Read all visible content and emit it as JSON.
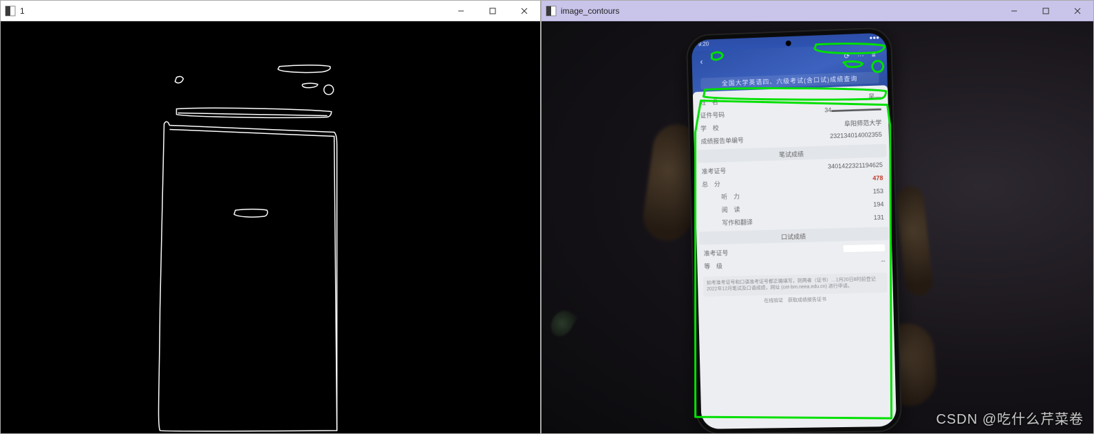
{
  "windows": {
    "w1": {
      "title": "1"
    },
    "w2": {
      "title": "image_contours"
    }
  },
  "phone": {
    "status_time": "9:20",
    "status_icons": "●●●",
    "header_back": "‹",
    "header_icons": "⟳  ⋯  ≡",
    "header_banner": "全国大学英语四、六级考试(含口试)成绩查询",
    "fields": {
      "name_lbl": "姓　名",
      "name_val": "吴—",
      "id_lbl": "证件号码",
      "id_val": "34▬▬▬▬▬▬▬▬",
      "school_lbl": "学　校",
      "school_val": "阜阳师范大学",
      "report_lbl": "成绩报告单编号",
      "report_val": "232134014002355"
    },
    "sec_written": "笔试成绩",
    "written": {
      "ticket_lbl": "准考证号",
      "ticket_val": "3401422321194625",
      "total_lbl": "总　分",
      "total_val": "478",
      "listen_lbl": "听　力",
      "listen_val": "153",
      "read_lbl": "阅　读",
      "read_val": "194",
      "write_lbl": "写作和翻译",
      "write_val": "131"
    },
    "sec_oral": "口试成绩",
    "oral": {
      "ticket_lbl": "准考证号",
      "ticket_val": "",
      "grade_lbl": "等　级",
      "grade_val": "--"
    },
    "note": "如考准考证号和口语准考证号都正确填写，则两者（证书）…1月20日8时前登记2022年12月笔试及口语成绩，网址 (cet-bm.neea.edu.cn) 进行申请。",
    "note2": "在线验证　获取成绩报告证书"
  },
  "watermark": "CSDN @吃什么芹菜卷"
}
